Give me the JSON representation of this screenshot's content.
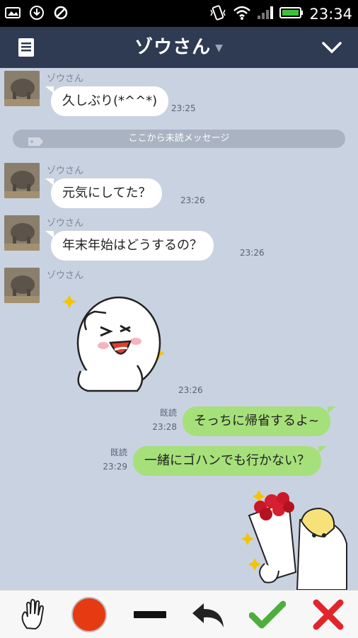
{
  "status_bar": {
    "time": "23:34"
  },
  "header": {
    "title": "ゾウさん",
    "dropdown_icon": "triangle-down-icon",
    "menu_icon": "list-icon",
    "collapse_icon": "chevron-down-icon"
  },
  "chat": {
    "unread_divider": "ここから未読メッセージ",
    "messages": [
      {
        "side": "left",
        "sender": "ゾウさん",
        "text": "久しぶり(*^^*)",
        "time": "23:25"
      },
      {
        "side": "left",
        "sender": "ゾウさん",
        "text": "元気にしてた？",
        "time": "23:26"
      },
      {
        "side": "left",
        "sender": "ゾウさん",
        "text": "年末年始はどうするの？",
        "time": "23:26"
      },
      {
        "side": "left",
        "sender": "ゾウさん",
        "sticker": "moon-wink-sticker",
        "time": "23:26"
      },
      {
        "side": "right",
        "read": "既読",
        "text": "そっちに帰省するよ~",
        "time": "23:28"
      },
      {
        "side": "right",
        "read": "既読",
        "text": "一緒にゴハンでも行かない？",
        "time": "23:29"
      },
      {
        "side": "right",
        "sticker": "bouquet-sticker"
      }
    ]
  },
  "toolbar": {
    "tools": [
      "hand-icon",
      "record-icon",
      "minus-icon",
      "undo-icon",
      "check-icon",
      "close-icon"
    ],
    "colors": {
      "record": "#e63a12",
      "check": "#4caf3c",
      "close": "#e0262a"
    }
  }
}
